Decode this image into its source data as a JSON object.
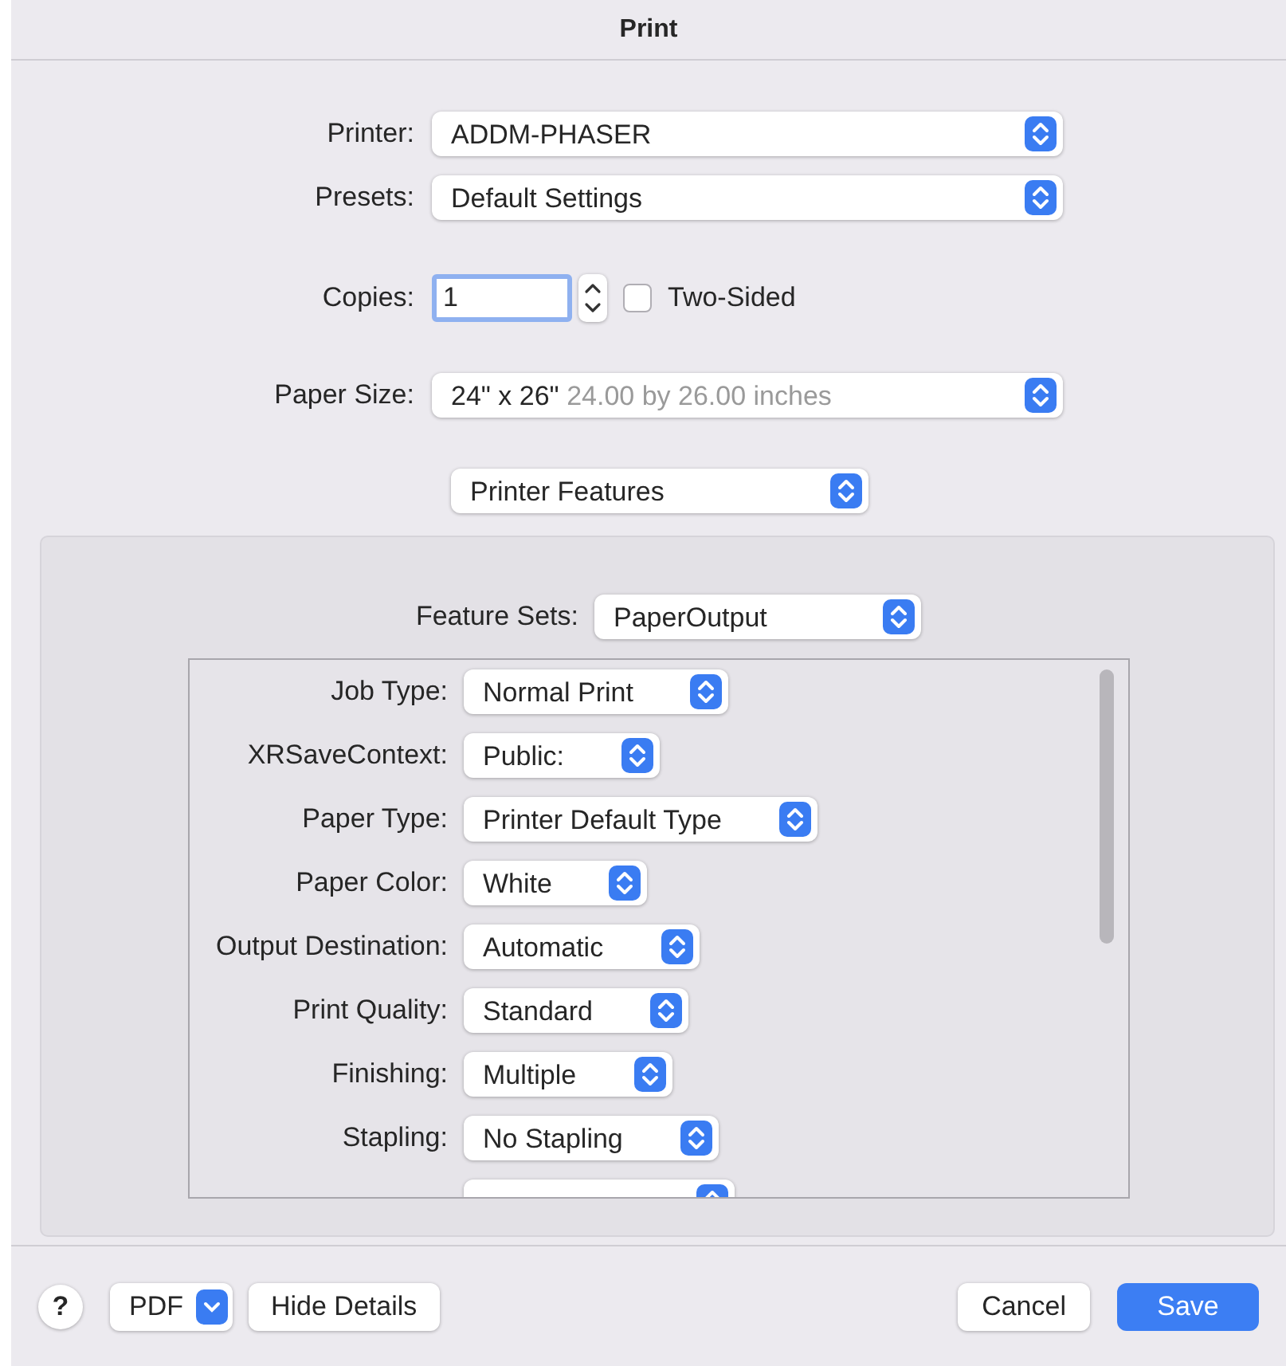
{
  "window": {
    "title": "Print"
  },
  "top_fields": [
    {
      "label": "Printer:",
      "value": "ADDM-PHASER"
    },
    {
      "label": "Presets:",
      "value": "Default Settings"
    }
  ],
  "copies": {
    "label": "Copies:",
    "value": "1",
    "two_sided": {
      "label": "Two-Sided",
      "checked": false
    }
  },
  "paper_size": {
    "label": "Paper Size:",
    "value": "24\" x 26\"",
    "note": "24.00 by 26.00 inches"
  },
  "section_popup": {
    "value": "Printer Features"
  },
  "feature_sets": {
    "label": "Feature Sets:",
    "value": "PaperOutput"
  },
  "features": [
    {
      "kind": "popup",
      "label": "Job Type:",
      "value": "Normal Print"
    },
    {
      "kind": "popup",
      "label": "XRSaveContext:",
      "value": "Public:"
    },
    {
      "kind": "popup",
      "label": "Paper Type:",
      "value": "Printer Default Type"
    },
    {
      "kind": "popup",
      "label": "Paper Color:",
      "value": "White"
    },
    {
      "kind": "popup",
      "label": "Output Destination:",
      "value": "Automatic"
    },
    {
      "kind": "popup",
      "label": "Print Quality:",
      "value": "Standard"
    },
    {
      "kind": "popup",
      "label": "Finishing:",
      "value": "Multiple"
    },
    {
      "kind": "popup",
      "label": "Stapling:",
      "value": "No Stapling"
    },
    {
      "kind": "cut_off"
    }
  ],
  "footer": {
    "help": "?",
    "pdf": "PDF",
    "details": "Hide Details",
    "cancel": "Cancel",
    "save": "Save"
  }
}
